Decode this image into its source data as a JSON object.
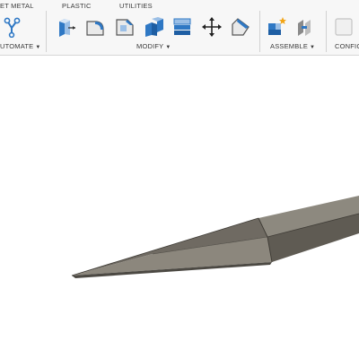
{
  "tabs": [
    "ET METAL",
    "PLASTIC",
    "UTILITIES"
  ],
  "groups": {
    "automate": "UTOMATE",
    "modify": "MODIFY",
    "assemble": "ASSEMBLE",
    "configure": "CONFIG"
  },
  "tools": {
    "automate": [
      "automate-icon"
    ],
    "modify": [
      "press-pull-icon",
      "fillet-icon",
      "chamfer-icon",
      "shell-icon",
      "combine-icon",
      "move-icon",
      "draft-icon"
    ],
    "assemble": [
      "new-component-icon",
      "joint-icon"
    ],
    "configure": [
      "configure-icon"
    ]
  },
  "colors": {
    "toolbar_bg": "#f7f7f7",
    "accent_blue": "#2f78c4",
    "body_gray": "#6e6a62",
    "viewport_bg": "#ffffff"
  }
}
